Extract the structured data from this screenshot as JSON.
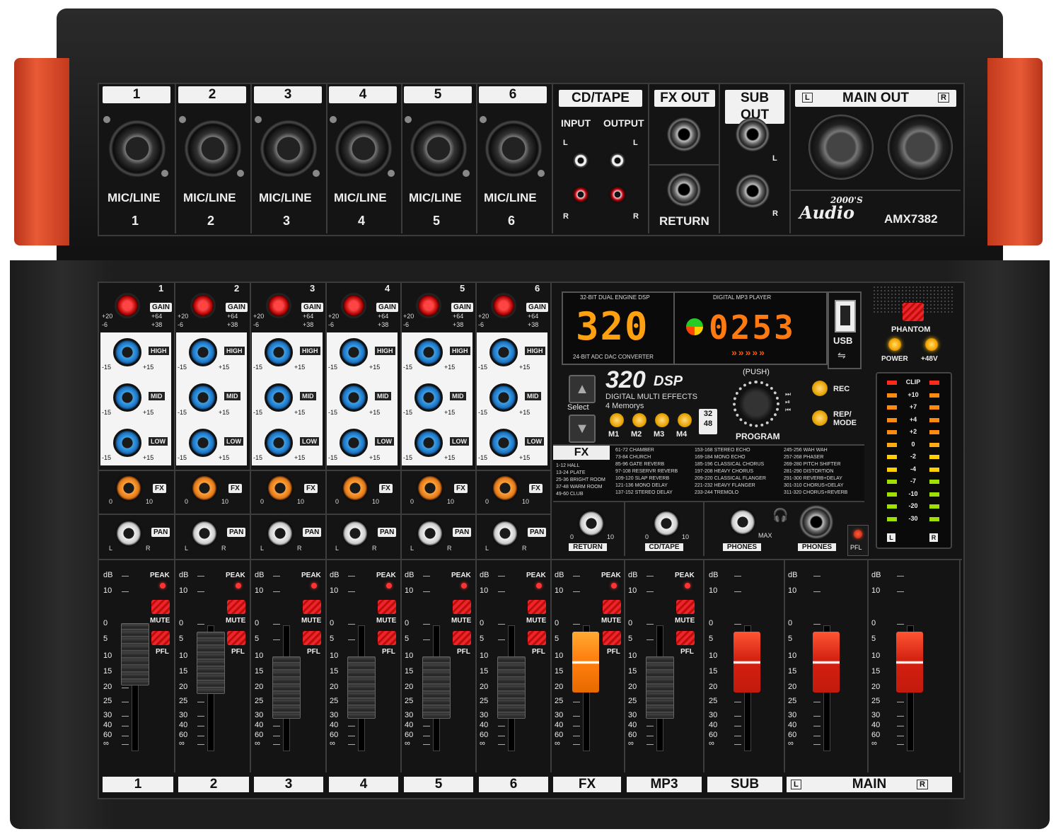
{
  "inputs": {
    "channels": [
      {
        "num": "1",
        "jack_label": "MIC/LINE",
        "jack_num": "1"
      },
      {
        "num": "2",
        "jack_label": "MIC/LINE",
        "jack_num": "2"
      },
      {
        "num": "3",
        "jack_label": "MIC/LINE",
        "jack_num": "3"
      },
      {
        "num": "4",
        "jack_label": "MIC/LINE",
        "jack_num": "4"
      },
      {
        "num": "5",
        "jack_label": "MIC/LINE",
        "jack_num": "5"
      },
      {
        "num": "6",
        "jack_label": "MIC/LINE",
        "jack_num": "6"
      }
    ],
    "cdtape": {
      "title": "CD/TAPE",
      "input": "INPUT",
      "output": "OUTPUT",
      "l": "L",
      "r": "R"
    },
    "fxout": {
      "title": "FX OUT",
      "return": "RETURN"
    },
    "subout": {
      "title": "SUB OUT",
      "l": "L",
      "r": "R"
    },
    "mainout": {
      "l": "L",
      "title": "MAIN OUT",
      "r": "R"
    },
    "brand": {
      "logo_year": "2000'S",
      "logo_word": "Audio",
      "model": "AMX7382"
    }
  },
  "channel_strip": {
    "gain": {
      "label": "GAIN",
      "left_top": "+20",
      "left_bot": "-6",
      "right_top": "+64",
      "right_bot": "+38"
    },
    "eq": [
      {
        "label": "HIGH",
        "min": "-15",
        "max": "+15"
      },
      {
        "label": "MID",
        "min": "-15",
        "max": "+15"
      },
      {
        "label": "LOW",
        "min": "-15",
        "max": "+15"
      }
    ],
    "fx": {
      "label": "FX",
      "min": "0",
      "max": "10"
    },
    "pan": {
      "label": "PAN",
      "l": "L",
      "r": "R"
    }
  },
  "dsp": {
    "engine_caption": "32-BIT DUAL ENGINE DSP",
    "mp3_caption": "DIGITAL MP3 PLAYER",
    "left_display": "320",
    "right_display": "0253",
    "converter": "24-BIT ADC DAC CONVERTER",
    "usb": "USB",
    "brand_big": "320",
    "brand_dsp": "DSP",
    "brand_sub": "DIGITAL MULTI EFFECTS",
    "memorys": "4 Memorys",
    "select": "Select",
    "memory_buttons": [
      "M1",
      "M2",
      "M3",
      "M4"
    ],
    "push": "(PUSH)",
    "program": "PROGRAM",
    "rec": "REC",
    "rep_mode_1": "REP/",
    "rep_mode_2": "MODE",
    "badge_top": "32",
    "badge_bot": "48"
  },
  "fx_table": {
    "title": "FX",
    "cols": [
      [
        "1-12  HALL",
        "13-24  PLATE",
        "25-36  BRIGHT ROOM",
        "37-48  WARM ROOM",
        "49-60  CLUB"
      ],
      [
        "61-72  CHAMBER",
        "73-84  CHURCH",
        "85-96  GATE REVERB",
        "97-108  RESERVR REVERB",
        "109-120  SLAP REVERB",
        "121-136  MONO DELAY",
        "137-152  STEREO DELAY"
      ],
      [
        "153-168  STEREO ECHO",
        "169-184  MONO ECHO",
        "185-196  CLASSICAL CHORUS",
        "197-208  HEAVY CHORUS",
        "209-220  CLASSICAL FLANGER",
        "221-232  HEAVY FLANGER",
        "233-244  TREMOLO"
      ],
      [
        "245-256  WAH WAH",
        "257-268  PHASER",
        "269-280  PITCH SHIFTER",
        "281-290  DISTORTION",
        "291-300  REVERB+DELAY",
        "301-310  CHORUS+DELAY",
        "311-320  CHORUS+REVERB"
      ]
    ]
  },
  "master_controls": {
    "return": {
      "label": "RETURN",
      "min": "0",
      "max": "10"
    },
    "cdtape": {
      "label": "CD/TAPE",
      "min": "0",
      "max": "10"
    },
    "phones_knob": {
      "label": "PHONES",
      "max": "MAX"
    },
    "phones_jack": {
      "label": "PHONES"
    },
    "pfl": "PFL"
  },
  "phantom": {
    "label": "PHANTOM",
    "power": "POWER",
    "v48": "+48V"
  },
  "meter": {
    "labels": [
      "CLIP",
      "+10",
      "+7",
      "+4",
      "+2",
      "0",
      "-2",
      "-4",
      "-7",
      "-10",
      "-20",
      "-30"
    ],
    "l": "L",
    "r": "R"
  },
  "faders": {
    "scale": [
      "dB",
      "10",
      "0",
      "5",
      "10",
      "15",
      "20",
      "25",
      "30",
      "40",
      "60",
      "∞"
    ],
    "peak": "PEAK",
    "mute": "MUTE",
    "pfl": "PFL",
    "strips": [
      {
        "label": "1",
        "level": 0.86,
        "cap": "black"
      },
      {
        "label": "2",
        "level": 0.84,
        "cap": "black"
      },
      {
        "label": "3",
        "level": 0.78,
        "cap": "black"
      },
      {
        "label": "4",
        "level": 0.78,
        "cap": "black"
      },
      {
        "label": "5",
        "level": 0.78,
        "cap": "black"
      },
      {
        "label": "6",
        "level": 0.78,
        "cap": "black"
      },
      {
        "label": "FX",
        "level": 0.84,
        "cap": "orange"
      },
      {
        "label": "MP3",
        "level": 0.78,
        "cap": "black"
      },
      {
        "label": "SUB",
        "level": 0.84,
        "cap": "red"
      },
      {
        "label": "MAIN",
        "level": 0.84,
        "cap": "red",
        "l": "L",
        "r": "R"
      },
      {
        "label": "",
        "level": 0.84,
        "cap": "red"
      }
    ]
  }
}
